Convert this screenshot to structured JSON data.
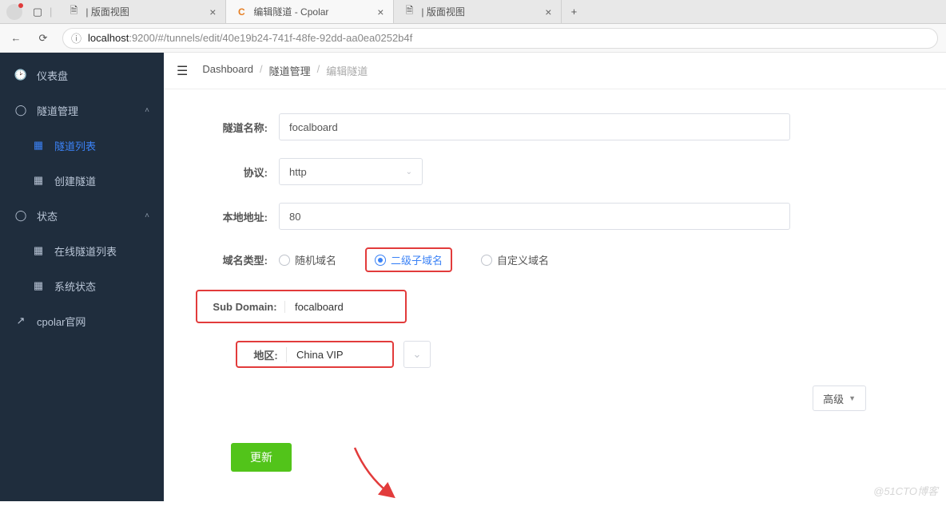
{
  "browser": {
    "tabs": [
      {
        "favicon": "🗎",
        "title": "| 版面视图"
      },
      {
        "favicon": "C",
        "title": "编辑隧道 - Cpolar",
        "active": true
      },
      {
        "favicon": "🗎",
        "title": "| 版面视图"
      }
    ],
    "url_host": "localhost",
    "url_port": ":9200",
    "url_path": "/#/tunnels/edit/40e19b24-741f-48fe-92dd-aa0ea0252b4f"
  },
  "sidebar": {
    "items": [
      {
        "icon": "◉",
        "label": "仪表盘",
        "type": "top"
      },
      {
        "icon": "◯",
        "label": "隧道管理",
        "type": "group",
        "expanded": true
      },
      {
        "icon": "▦",
        "label": "隧道列表",
        "type": "sub",
        "selected": true
      },
      {
        "icon": "▦",
        "label": "创建隧道",
        "type": "sub"
      },
      {
        "icon": "◯",
        "label": "状态",
        "type": "group",
        "expanded": true
      },
      {
        "icon": "▦",
        "label": "在线隧道列表",
        "type": "sub"
      },
      {
        "icon": "▦",
        "label": "系统状态",
        "type": "sub"
      },
      {
        "icon": "↗",
        "label": "cpolar官网",
        "type": "top"
      }
    ]
  },
  "breadcrumb": {
    "a": "Dashboard",
    "b": "隧道管理",
    "c": "编辑隧道"
  },
  "form": {
    "name_label": "隧道名称:",
    "name_value": "focalboard",
    "proto_label": "协议:",
    "proto_value": "http",
    "addr_label": "本地地址:",
    "addr_value": "80",
    "domain_type_label": "域名类型:",
    "domain_opts": {
      "random": "随机域名",
      "sub": "二级子域名",
      "custom": "自定义域名"
    },
    "subdomain_label": "Sub Domain:",
    "subdomain_value": "focalboard",
    "region_label": "地区:",
    "region_value": "China VIP",
    "advanced_label": "高级",
    "submit_label": "更新"
  },
  "watermark": "@51CTO博客"
}
